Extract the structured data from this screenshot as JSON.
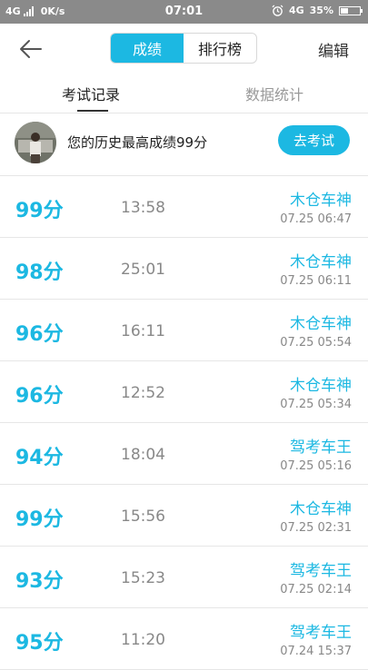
{
  "status_bar": {
    "network": "4G",
    "speed": "0K/s",
    "time": "07:01",
    "network_right": "4G",
    "battery": "35%"
  },
  "header": {
    "back_icon": "back-arrow-icon",
    "tabs": [
      {
        "label": "成绩",
        "active": true
      },
      {
        "label": "排行榜",
        "active": false
      }
    ],
    "edit_label": "编辑"
  },
  "subtabs": [
    {
      "label": "考试记录",
      "active": true
    },
    {
      "label": "数据统计",
      "active": false
    }
  ],
  "summary": {
    "text": "您的历史最高成绩99分",
    "button_label": "去考试"
  },
  "records": [
    {
      "score": "99分",
      "duration": "13:58",
      "title": "木仓车神",
      "date": "07.25  06:47"
    },
    {
      "score": "98分",
      "duration": "25:01",
      "title": "木仓车神",
      "date": "07.25  06:11"
    },
    {
      "score": "96分",
      "duration": "16:11",
      "title": "木仓车神",
      "date": "07.25  05:54"
    },
    {
      "score": "96分",
      "duration": "12:52",
      "title": "木仓车神",
      "date": "07.25  05:34"
    },
    {
      "score": "94分",
      "duration": "18:04",
      "title": "驾考车王",
      "date": "07.25  05:16"
    },
    {
      "score": "99分",
      "duration": "15:56",
      "title": "木仓车神",
      "date": "07.25  02:31"
    },
    {
      "score": "93分",
      "duration": "15:23",
      "title": "驾考车王",
      "date": "07.25  02:14"
    },
    {
      "score": "95分",
      "duration": "11:20",
      "title": "驾考车王",
      "date": "07.24  15:37"
    }
  ],
  "colors": {
    "accent": "#1cb8e2",
    "status_bar": "#8a8a8a"
  }
}
